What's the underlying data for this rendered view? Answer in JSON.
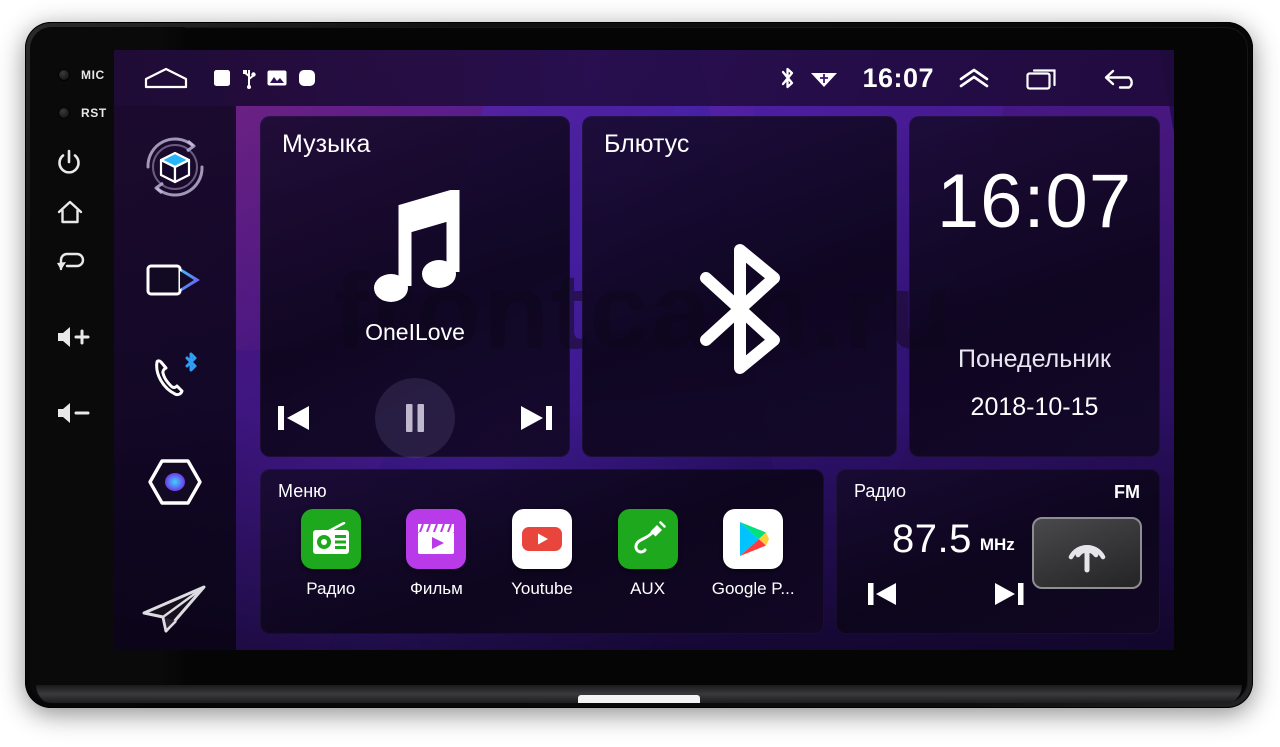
{
  "device": {
    "hardware_buttons": [
      {
        "name": "mic",
        "label": "MIC",
        "type": "pinhole"
      },
      {
        "name": "reset",
        "label": "RST",
        "type": "pinhole"
      },
      {
        "name": "power",
        "label": "",
        "icon": "power-icon"
      },
      {
        "name": "home",
        "label": "",
        "icon": "home-icon"
      },
      {
        "name": "back",
        "label": "",
        "icon": "back-icon"
      },
      {
        "name": "volume-up",
        "label": "+",
        "icon": "volume-up-icon"
      },
      {
        "name": "volume-down",
        "label": "−",
        "icon": "volume-down-icon"
      }
    ]
  },
  "statusbar": {
    "left_icons": [
      "home-outline-icon",
      "square-icon",
      "usb-icon",
      "image-icon",
      "rounded-square-icon"
    ],
    "bluetooth_icon": "bluetooth-icon",
    "wifi_icon": "wifi-icon",
    "time": "16:07",
    "expand_icon": "chevron-up-icon",
    "recents_icon": "recent-apps-icon",
    "back_icon": "back-arrow-icon"
  },
  "rail": {
    "items": [
      {
        "name": "apps",
        "icon": "cube-apps-icon"
      },
      {
        "name": "video",
        "icon": "video-icon"
      },
      {
        "name": "bluetooth-phone",
        "icon": "bluetooth-phone-icon"
      },
      {
        "name": "settings",
        "icon": "hexagon-settings-icon"
      }
    ],
    "navigation_icon": "paper-plane-icon"
  },
  "widgets": {
    "music": {
      "title": "Музыка",
      "track": "OneILove",
      "icon": "music-note-icon",
      "prev_label": "prev-track",
      "play_label": "pause",
      "next_label": "next-track"
    },
    "bluetooth": {
      "title": "Блютус",
      "icon": "bluetooth-large-icon"
    },
    "clock": {
      "time": "16:07",
      "weekday": "Понедельник",
      "date": "2018-10-15"
    },
    "menu": {
      "title": "Меню",
      "apps": [
        {
          "label": "Радио",
          "icon": "radio-app-icon",
          "color": "#1ea81e"
        },
        {
          "label": "Фильм",
          "icon": "movie-app-icon",
          "color": "#b83ae8"
        },
        {
          "label": "Youtube",
          "icon": "youtube-app-icon",
          "color": "#ffffff"
        },
        {
          "label": "AUX",
          "icon": "aux-app-icon",
          "color": "#1ea81e"
        },
        {
          "label": "Google P...",
          "icon": "google-play-app-icon",
          "color": "#ffffff"
        }
      ]
    },
    "radio": {
      "title": "Радио",
      "band": "FM",
      "frequency": "87.5",
      "unit": "MHz",
      "prev_label": "seek-down",
      "next_label": "seek-up",
      "antenna_icon": "antenna-broadcast-icon"
    }
  },
  "watermark": {
    "text": "frontcam.ru"
  },
  "colors": {
    "accent_purple": "#7b2fd4",
    "accent_blue": "#2f6fe0",
    "green": "#1ea81e",
    "youtube_red": "#e8463c",
    "movie_purple": "#b83ae8"
  }
}
